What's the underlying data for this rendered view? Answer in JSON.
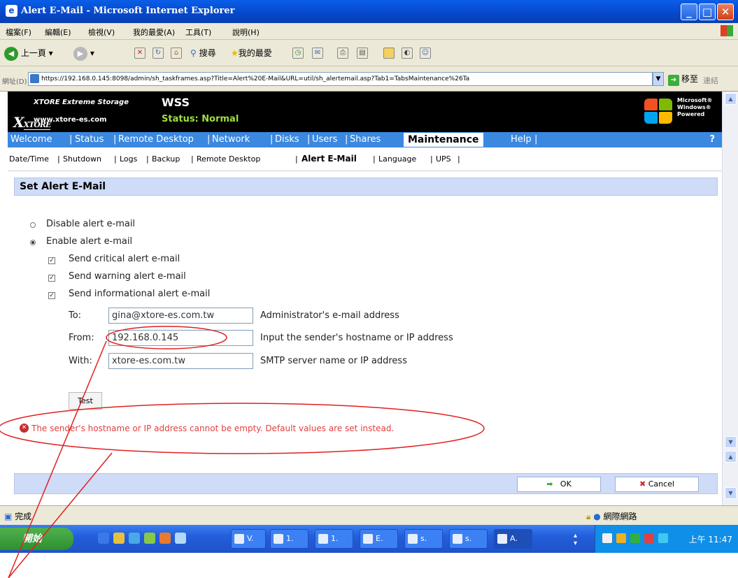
{
  "window": {
    "title": "Alert E-Mail - Microsoft Internet Explorer",
    "controls": {
      "minimize": "_",
      "maximize": "□",
      "close": "✕"
    }
  },
  "menu": [
    "檔案(F)",
    "編輯(E)",
    "檢視(V)",
    "我的最愛(A)",
    "工具(T)",
    "說明(H)"
  ],
  "toolbar": {
    "back": "上一頁",
    "search": "搜尋",
    "favorites": "我的最愛"
  },
  "address": {
    "label": "網址(D)",
    "url": "https://192.168.0.145:8098/admin/sh_taskframes.asp?Title=Alert%20E-Mail&URL=util/sh_alertemail.asp?Tab1=TabsMaintenance%26Ta",
    "go": "移至",
    "links": "連結"
  },
  "banner": {
    "brand": "XTORE Extreme Storage",
    "logo": "XTORE",
    "url": "www.xtore-es.com",
    "product": "WSS",
    "status": "Status: Normal",
    "windows_badge": [
      "Microsoft®",
      "Windows®",
      "Powered"
    ]
  },
  "tabs": [
    "Welcome",
    "Status",
    "Remote Desktop",
    "Network",
    "Disks",
    "Users",
    "Shares",
    "Maintenance",
    "Help"
  ],
  "help_q": "?",
  "subtabs": [
    "Date/Time",
    "Shutdown",
    "Logs",
    "Backup",
    "Remote Desktop",
    "Alert E-Mail",
    "Language",
    "UPS"
  ],
  "section_title": "Set Alert E-Mail",
  "options": {
    "disable": "Disable alert e-mail",
    "enable": "Enable alert e-mail",
    "critical": "Send critical alert e-mail",
    "warning": "Send warning alert e-mail",
    "informational": "Send informational alert e-mail"
  },
  "fields": {
    "to_label": "To:",
    "to_value": "gina@xtore-es.com.tw",
    "to_hint": "Administrator's e-mail address",
    "from_label": "From:",
    "from_value": "192.168.0.145",
    "from_hint": "Input the sender's hostname or IP address",
    "with_label": "With:",
    "with_value": "xtore-es.com.tw",
    "with_hint": "SMTP server name or IP address"
  },
  "test_button": "Test",
  "error": "The sender's hostname or IP address cannot be empty. Default values are set instead.",
  "footer": {
    "ok": "OK",
    "cancel": "Cancel"
  },
  "statusbar": {
    "done": "完成",
    "zone": "網際網路"
  },
  "taskbar": {
    "start": "開始",
    "items": [
      "V.",
      "1.",
      "1.",
      "E.",
      "s.",
      "s.",
      "A."
    ],
    "clock": "上午 11:47"
  },
  "colors": {
    "tab_bar": "#3a88e0",
    "status_text": "#9fdf3f",
    "error": "#e04040",
    "annotation": "#e02020"
  }
}
